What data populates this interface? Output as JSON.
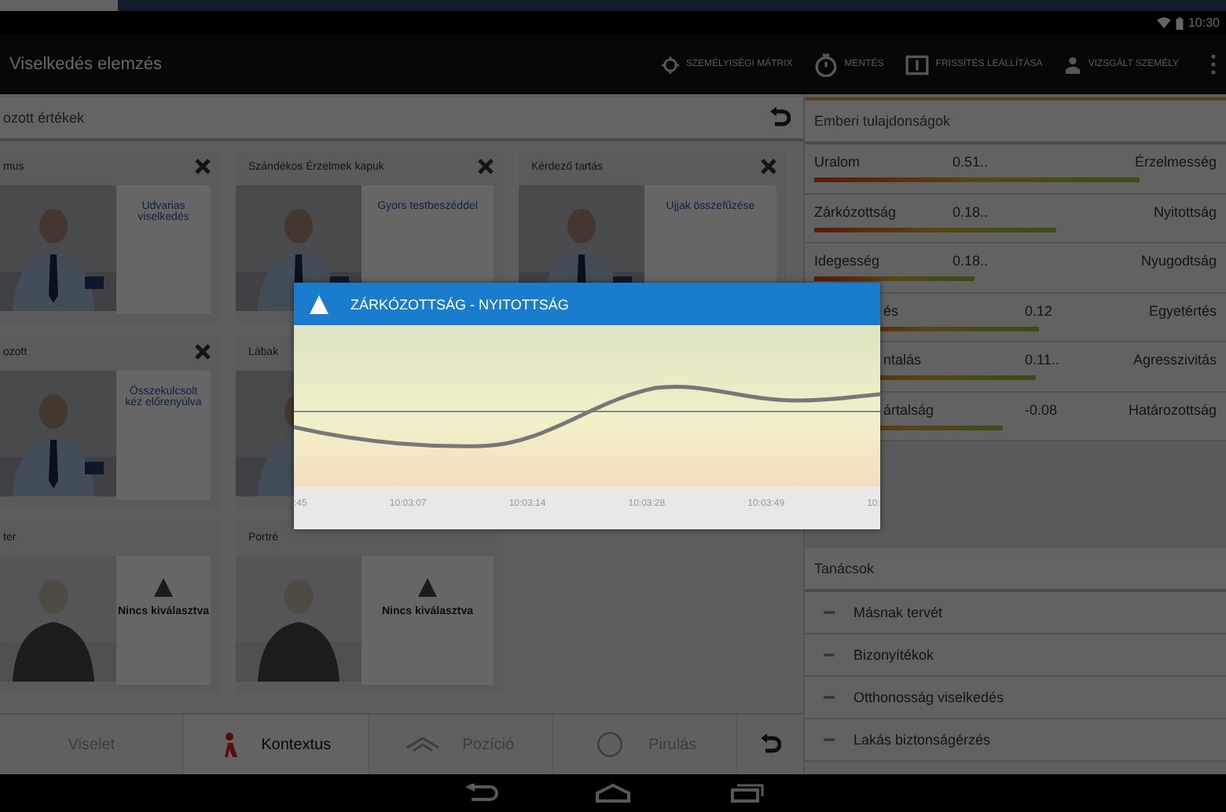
{
  "status_bar": {
    "time": "10:30"
  },
  "action_bar": {
    "title": "Viselkedés elemzés",
    "actions": [
      {
        "kind": "target",
        "label": "SZEMÉLYISÉGI MÁTRIX"
      },
      {
        "kind": "timer",
        "label": "MENTÉS"
      },
      {
        "kind": "screen",
        "label": "FRISSÍTÉS LEÁLLÍTÁSA"
      },
      {
        "kind": "person",
        "label": "VIZSGÁLT SZEMÉLY"
      }
    ]
  },
  "left_panel": {
    "title": "ozott értékek",
    "cards": [
      {
        "kind": "link",
        "title": "mus",
        "text": "Udvarias viselkedés"
      },
      {
        "kind": "link",
        "title": "Szándékos Érzelmek kapuk",
        "text": "Gyors testbeszéddel"
      },
      {
        "kind": "link",
        "title": "Kérdező tartás",
        "text": "Ujjak összefűzése"
      },
      {
        "kind": "link",
        "title": "ozott",
        "text": "Összekulcsolt kéz előrenyúlva"
      },
      {
        "kind": "hidden",
        "title": "Lábak"
      },
      {
        "kind": "none",
        "title": "ter",
        "text": "Nincs kiválasztva"
      },
      {
        "kind": "none",
        "title": "Portré",
        "text": "Nincs kiválasztva"
      }
    ]
  },
  "bottom_tabs": [
    {
      "kind": "plain",
      "label": "Viselet",
      "selected": false
    },
    {
      "kind": "figure",
      "label": "Kontextus",
      "selected": true
    },
    {
      "kind": "hands",
      "label": "Pozíció",
      "selected": false
    },
    {
      "kind": "circle",
      "label": "Pirulás",
      "selected": false
    }
  ],
  "right_panel": {
    "title": "Emberi tulajdonságok",
    "traits": [
      {
        "left": "Uralom",
        "value": "0.51..",
        "right": "Érzelmesség",
        "level": 0.81
      },
      {
        "left": "Zárkózottság",
        "value": "0.18..",
        "right": "Nyitottság",
        "level": 0.6
      },
      {
        "left": "Idegesség",
        "value": "0.18..",
        "right": "Nyugodtság",
        "level": 0.4
      },
      {
        "left": "és",
        "value": "0.12",
        "right": "Egyetértés",
        "level": 0.56
      },
      {
        "left": "ntalás",
        "value": "0.11..",
        "right": "Agresszivitás",
        "level": 0.55
      },
      {
        "left": "ártalság",
        "value": "-0.08",
        "right": "Határozottság",
        "level": 0.47
      }
    ],
    "advice": {
      "title": "Tanácsok",
      "items": [
        "Másnak tervét",
        "Bizonyítékok",
        "Otthonosság viselkedés",
        "Lakás biztonságérzés"
      ]
    }
  },
  "dialog": {
    "title": "ZÁRKÓZOTTSÁG - NYITOTTSÁG",
    "x_labels": [
      ":45",
      "10:03:07",
      "10:03:14",
      "10:03:28",
      "10:03:49",
      "10:"
    ]
  }
}
